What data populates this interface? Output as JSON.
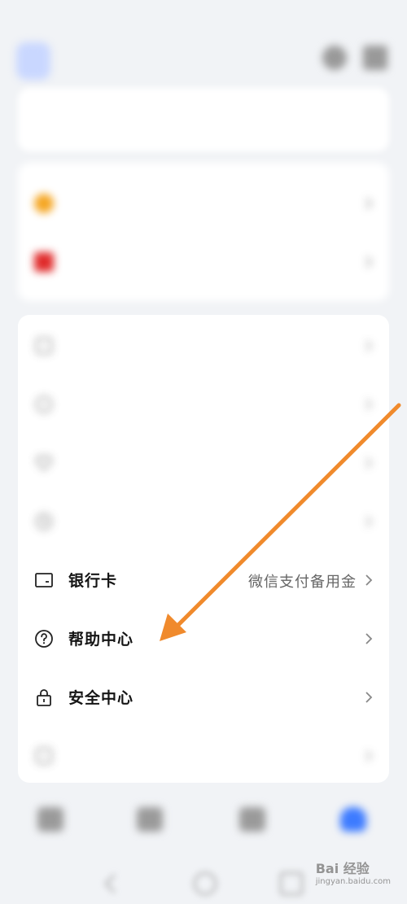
{
  "status_bar": {
    "time": "",
    "right": ""
  },
  "header": {
    "line1": "",
    "line2": ""
  },
  "stats": {
    "items": [
      "",
      "",
      "",
      "",
      ""
    ]
  },
  "member": {
    "rows": [
      {
        "label": "",
        "sub": "",
        "icon": "star-icon",
        "color": "#f5a623"
      },
      {
        "label": "",
        "sub": "",
        "icon": "card-icon",
        "color": "#e02b2b"
      }
    ]
  },
  "menu": {
    "blurred_rows": [
      {
        "label": "",
        "icon": "book-icon"
      },
      {
        "label": "",
        "icon": "list-icon"
      },
      {
        "label": "",
        "icon": "heart-icon"
      },
      {
        "label": "",
        "icon": "clock-icon"
      }
    ],
    "bank_card": {
      "label": "银行卡",
      "sub": "微信支付备用金",
      "icon": "bank-card-icon"
    },
    "help_center": {
      "label": "帮助中心",
      "icon": "question-circle-icon"
    },
    "security_center": {
      "label": "安全中心",
      "icon": "lock-icon"
    },
    "settings": {
      "label": "",
      "icon": "gear-icon"
    }
  },
  "bottom_nav": {
    "items": [
      {
        "label": "",
        "icon": "home-icon"
      },
      {
        "label": "",
        "icon": "grid-icon"
      },
      {
        "label": "",
        "icon": "doc-icon"
      },
      {
        "label": "",
        "icon": "user-icon",
        "active": true
      }
    ],
    "accent": "#3d7bff"
  },
  "annotation": {
    "arrow_color": "#f08a2c"
  },
  "watermark": {
    "text": "Bai 经验",
    "sub": "jingyan.baidu.com"
  }
}
